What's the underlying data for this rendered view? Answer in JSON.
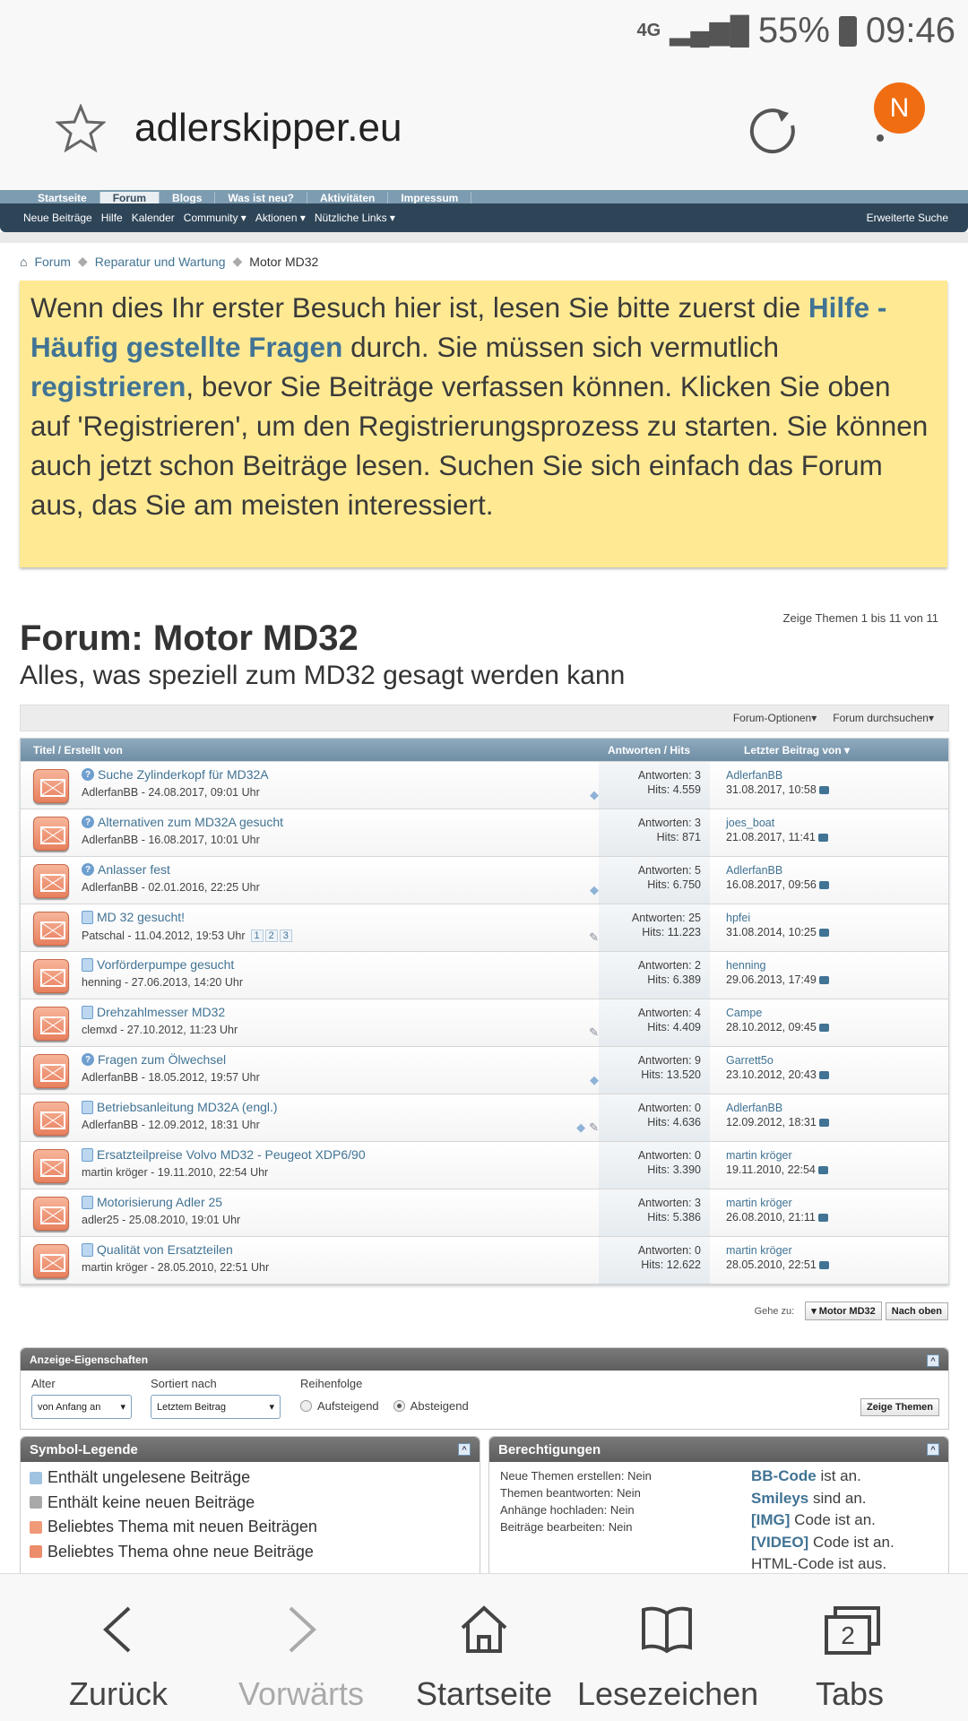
{
  "status": {
    "network": "4G",
    "battery": "55%",
    "time": "09:46"
  },
  "browser": {
    "url": "adlerskipper.eu",
    "avatar_letter": "N"
  },
  "tabs": [
    "Startseite",
    "Forum",
    "Blogs",
    "Was ist neu?",
    "Aktivitäten",
    "Impressum"
  ],
  "nav": {
    "items": [
      "Neue Beiträge",
      "Hilfe",
      "Kalender",
      "Community ▾",
      "Aktionen ▾",
      "Nützliche Links ▾"
    ],
    "advanced_search": "Erweiterte Suche"
  },
  "breadcrumb": [
    "Forum",
    "Reparatur und Wartung",
    "Motor MD32"
  ],
  "notice": {
    "p1": "Wenn dies Ihr erster Besuch hier ist, lesen Sie bitte zuerst die ",
    "faq": "Hilfe - Häufig gestellte Fragen",
    "p2": " durch. Sie müssen sich vermutlich ",
    "register": "registrieren",
    "p3": ", bevor Sie Beiträge verfassen können. Klicken Sie oben auf 'Registrieren', um den Registrierungsprozess zu starten. Sie können auch jetzt schon Beiträge lesen. Suchen Sie sich einfach das Forum aus, das Sie am meisten interessiert."
  },
  "forum": {
    "count": "Zeige Themen 1 bis 11 von 11",
    "title": "Forum: Motor MD32",
    "subtitle": "Alles, was speziell zum MD32 gesagt werden kann",
    "options": "Forum-Optionen▾",
    "search": "Forum durchsuchen▾"
  },
  "table": {
    "col_title": "Titel / Erstellt von",
    "col_stats": "Antworten / Hits",
    "col_last": "Letzter Beitrag von ▾",
    "rows": [
      {
        "icon": "question",
        "title": "Suche Zylinderkopf für MD32A",
        "by": "AdlerfanBB - 24.08.2017, 09:01 Uhr",
        "replies": "Antworten: 3",
        "hits": "Hits: 4.559",
        "last_user": "AdlerfanBB",
        "last_date": "31.08.2017, 10:58",
        "marks": "tag"
      },
      {
        "icon": "question",
        "title": "Alternativen zum MD32A gesucht",
        "by": "AdlerfanBB - 16.08.2017, 10:01 Uhr",
        "replies": "Antworten: 3",
        "hits": "Hits: 871",
        "last_user": "joes_boat",
        "last_date": "21.08.2017, 11:41",
        "marks": ""
      },
      {
        "icon": "question",
        "title": "Anlasser fest",
        "by": "AdlerfanBB - 02.01.2016, 22:25 Uhr",
        "replies": "Antworten: 5",
        "hits": "Hits: 6.750",
        "last_user": "AdlerfanBB",
        "last_date": "16.08.2017, 09:56",
        "marks": "tag"
      },
      {
        "icon": "doc",
        "title": "MD 32 gesucht!",
        "by": "Patschal - 11.04.2012, 19:53 Uhr",
        "pages": [
          "1",
          "2",
          "3"
        ],
        "replies": "Antworten: 25",
        "hits": "Hits: 11.223",
        "last_user": "hpfei",
        "last_date": "31.08.2014, 10:25",
        "marks": "clip"
      },
      {
        "icon": "doc",
        "title": "Vorförderpumpe gesucht",
        "by": "henning - 27.06.2013, 14:20 Uhr",
        "replies": "Antworten: 2",
        "hits": "Hits: 6.389",
        "last_user": "henning",
        "last_date": "29.06.2013, 17:49",
        "marks": ""
      },
      {
        "icon": "doc",
        "title": "Drehzahlmesser MD32",
        "by": "clemxd - 27.10.2012, 11:23 Uhr",
        "replies": "Antworten: 4",
        "hits": "Hits: 4.409",
        "last_user": "Campe",
        "last_date": "28.10.2012, 09:45",
        "marks": "clip"
      },
      {
        "icon": "question",
        "title": "Fragen zum Ölwechsel",
        "by": "AdlerfanBB - 18.05.2012, 19:57 Uhr",
        "replies": "Antworten: 9",
        "hits": "Hits: 13.520",
        "last_user": "Garrett5o",
        "last_date": "23.10.2012, 20:43",
        "marks": "tag"
      },
      {
        "icon": "doc",
        "title": "Betriebsanleitung MD32A (engl.)",
        "by": "AdlerfanBB - 12.09.2012, 18:31 Uhr",
        "replies": "Antworten: 0",
        "hits": "Hits: 4.636",
        "last_user": "AdlerfanBB",
        "last_date": "12.09.2012, 18:31",
        "marks": "tag clip"
      },
      {
        "icon": "doc",
        "title": "Ersatzteilpreise Volvo MD32 - Peugeot XDP6/90",
        "by": "martin kröger - 19.11.2010, 22:54 Uhr",
        "replies": "Antworten: 0",
        "hits": "Hits: 3.390",
        "last_user": "martin kröger",
        "last_date": "19.11.2010, 22:54",
        "marks": ""
      },
      {
        "icon": "doc",
        "title": "Motorisierung Adler 25",
        "by": "adler25 - 25.08.2010, 19:01 Uhr",
        "replies": "Antworten: 3",
        "hits": "Hits: 5.386",
        "last_user": "martin kröger",
        "last_date": "26.08.2010, 21:11",
        "marks": ""
      },
      {
        "icon": "doc",
        "title": "Qualität von Ersatzteilen",
        "by": "martin kröger - 28.05.2010, 22:51 Uhr",
        "replies": "Antworten: 0",
        "hits": "Hits: 12.622",
        "last_user": "martin kröger",
        "last_date": "28.05.2010, 22:51",
        "marks": ""
      }
    ]
  },
  "goto": {
    "label": "Gehe zu:",
    "forum": "▾ Motor MD32",
    "top": "Nach oben"
  },
  "display": {
    "title": "Anzeige-Eigenschaften",
    "age_label": "Alter",
    "age_value": "von Anfang an",
    "sort_label": "Sortiert nach",
    "sort_value": "Letztem Beitrag",
    "order_label": "Reihenfolge",
    "asc": "Aufsteigend",
    "desc": "Absteigend",
    "submit": "Zeige Themen"
  },
  "legend": {
    "title": "Symbol-Legende",
    "items": [
      "Enthält ungelesene Beiträge",
      "Enthält keine neuen Beiträge",
      "Beliebtes Thema mit neuen Beiträgen",
      "Beliebtes Thema ohne neue Beiträge"
    ],
    "colors": [
      "#9fc3e0",
      "#a9a9a9",
      "#f09a7a",
      "#ec8c6a"
    ]
  },
  "perms": {
    "title": "Berechtigungen",
    "items": [
      "Neue Themen erstellen: Nein",
      "Themen beantworten: Nein",
      "Anhänge hochladen: Nein",
      "Beiträge bearbeiten: Nein"
    ],
    "codes": [
      {
        "b": "BB-Code",
        "t": " ist an."
      },
      {
        "b": "Smileys",
        "t": " sind an."
      },
      {
        "b": "[IMG]",
        "t": " Code ist an."
      },
      {
        "b": "[VIDEO]",
        "t": " Code ist an."
      },
      {
        "b": "",
        "t": "HTML-Code ist aus."
      }
    ]
  },
  "bottom": {
    "back": "Zurück",
    "forward": "Vorwärts",
    "home": "Startseite",
    "bookmarks": "Lesezeichen",
    "tabs": "Tabs",
    "tab_count": "2"
  }
}
